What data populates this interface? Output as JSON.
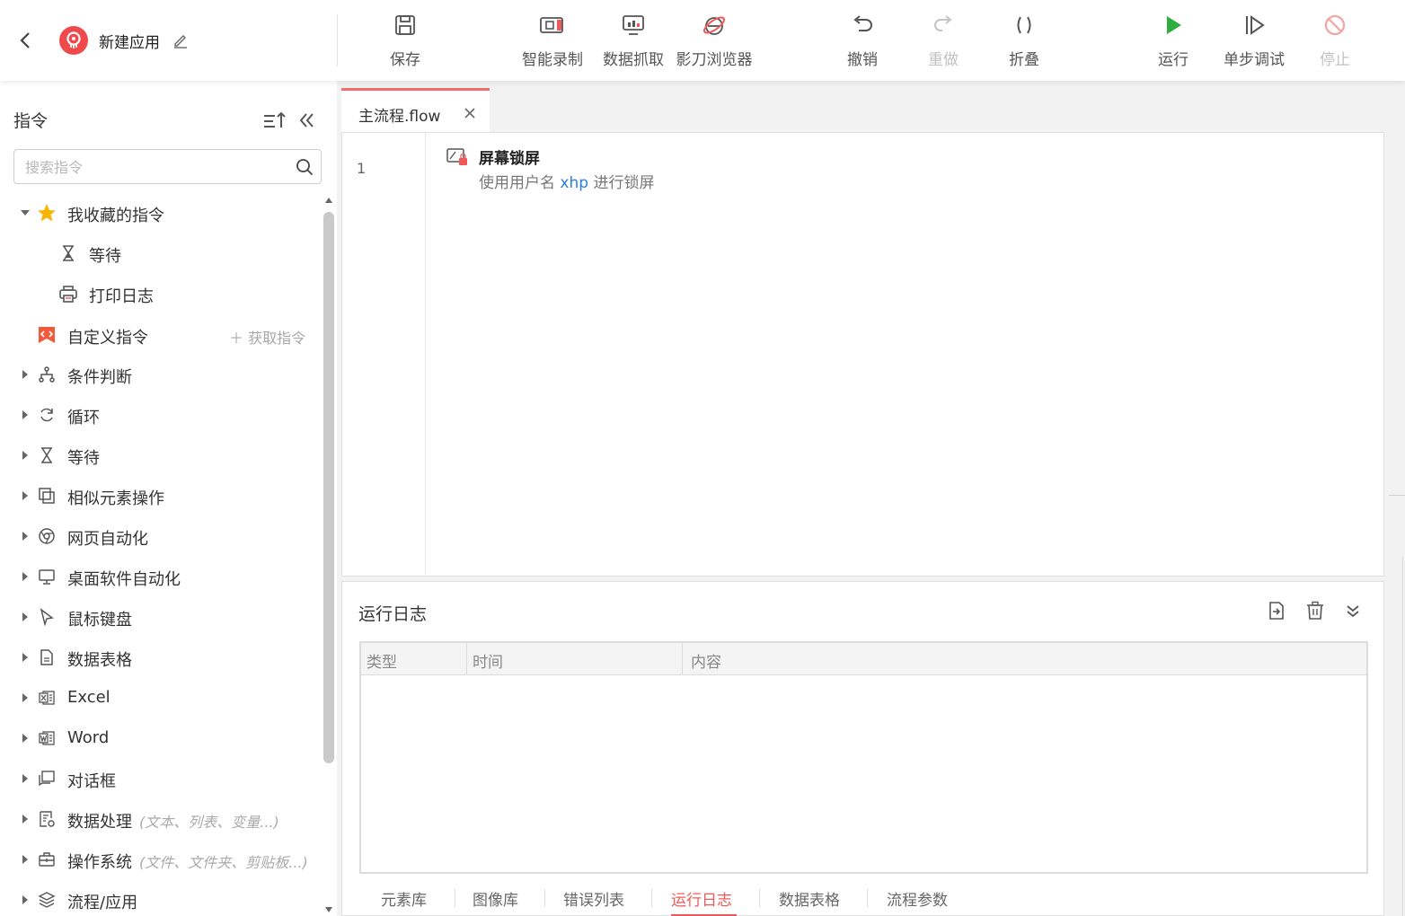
{
  "app": {
    "name": "新建应用"
  },
  "toolbar": [
    {
      "label": "保存",
      "icon": "save-icon",
      "enabled": true
    },
    {
      "label": "智能录制",
      "icon": "record-icon",
      "enabled": true
    },
    {
      "label": "数据抓取",
      "icon": "data-scrape-icon",
      "enabled": true
    },
    {
      "label": "影刀浏览器",
      "icon": "browser-icon",
      "enabled": true
    },
    {
      "label": "撤销",
      "icon": "undo-icon",
      "enabled": true
    },
    {
      "label": "重做",
      "icon": "redo-icon",
      "enabled": false
    },
    {
      "label": "折叠",
      "icon": "fold-icon",
      "enabled": true
    },
    {
      "label": "运行",
      "icon": "play-icon",
      "enabled": true
    },
    {
      "label": "单步调试",
      "icon": "step-debug-icon",
      "enabled": true
    },
    {
      "label": "停止",
      "icon": "stop-icon",
      "enabled": false
    }
  ],
  "sidebar": {
    "title": "指令",
    "search_placeholder": "搜索指令",
    "favorites": {
      "label": "我收藏的指令",
      "expanded": true,
      "items": [
        {
          "label": "等待",
          "icon": "hourglass-icon"
        },
        {
          "label": "打印日志",
          "icon": "printer-icon"
        }
      ]
    },
    "custom": {
      "label": "自定义指令",
      "action": "获取指令"
    },
    "categories": [
      {
        "label": "条件判断",
        "icon": "branch-icon",
        "hint": ""
      },
      {
        "label": "循环",
        "icon": "loop-icon",
        "hint": ""
      },
      {
        "label": "等待",
        "icon": "hourglass-icon",
        "hint": ""
      },
      {
        "label": "相似元素操作",
        "icon": "similar-elements-icon",
        "hint": ""
      },
      {
        "label": "网页自动化",
        "icon": "chrome-icon",
        "hint": ""
      },
      {
        "label": "桌面软件自动化",
        "icon": "monitor-icon",
        "hint": ""
      },
      {
        "label": "鼠标键盘",
        "icon": "cursor-icon",
        "hint": ""
      },
      {
        "label": "数据表格",
        "icon": "document-icon",
        "hint": ""
      },
      {
        "label": "Excel",
        "icon": "excel-icon",
        "hint": ""
      },
      {
        "label": "Word",
        "icon": "word-icon",
        "hint": ""
      },
      {
        "label": "对话框",
        "icon": "dialog-icon",
        "hint": ""
      },
      {
        "label": "数据处理",
        "icon": "data-process-icon",
        "hint": "(文本、列表、变量...)"
      },
      {
        "label": "操作系统",
        "icon": "briefcase-icon",
        "hint": "(文件、文件夹、剪贴板...)"
      },
      {
        "label": "流程/应用",
        "icon": "layers-icon",
        "hint": ""
      }
    ]
  },
  "editor": {
    "tab": "主流程.flow",
    "lines": [
      {
        "number": "1",
        "title": "屏幕锁屏",
        "desc_prefix": "使用用户名",
        "desc_var": "xhp",
        "desc_suffix": "进行锁屏",
        "icon": "lock-screen-icon"
      }
    ]
  },
  "log_panel": {
    "title": "运行日志",
    "columns": [
      "类型",
      "时间",
      "内容"
    ],
    "rows": [],
    "tabs": [
      "元素库",
      "图像库",
      "错误列表",
      "运行日志",
      "数据表格",
      "流程参数"
    ],
    "active_tab": "运行日志"
  },
  "colors": {
    "accent": "#ee5a5a",
    "run_green": "#2eae3f",
    "var_blue": "#2b7de0",
    "logo_red": "#f0494b",
    "star_yellow": "#f7b500"
  }
}
